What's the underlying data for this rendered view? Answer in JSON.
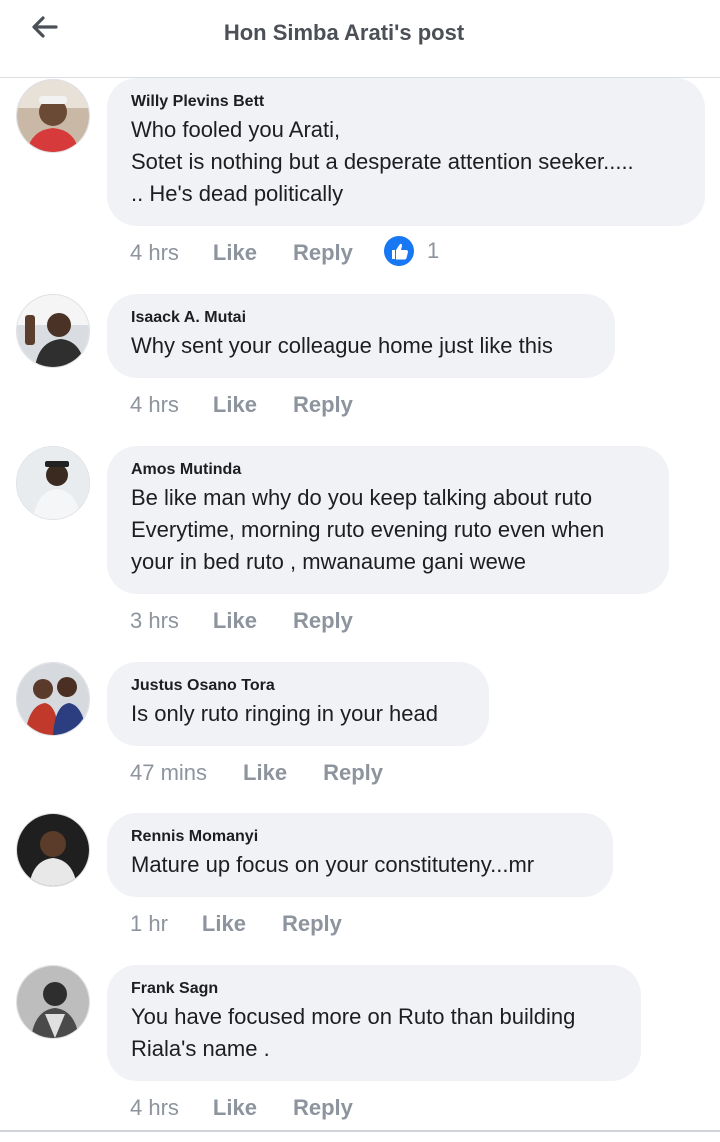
{
  "header": {
    "title": "Hon Simba Arati's post",
    "back_icon": "arrow-left-icon"
  },
  "comments": [
    {
      "author": "Willy Plevins Bett",
      "lines": [
        "Who fooled you Arati,",
        "Sotet is nothing but a desperate attention seeker.....",
        ".. He's dead politically"
      ],
      "time": "4 hrs",
      "like": "Like",
      "reply": "Reply",
      "reaction_count": "1"
    },
    {
      "author": "Isaack A. Mutai",
      "lines": [
        "Why sent your colleague home just like this"
      ],
      "time": "4 hrs",
      "like": "Like",
      "reply": "Reply"
    },
    {
      "author": "Amos Mutinda",
      "lines": [
        "Be like man why do you keep talking about ruto",
        "Everytime, morning ruto evening ruto even when",
        "your in bed ruto , mwanaume gani wewe"
      ],
      "time": "3 hrs",
      "like": "Like",
      "reply": "Reply"
    },
    {
      "author": "Justus Osano Tora",
      "lines": [
        "Is only ruto ringing in your head"
      ],
      "time": "47 mins",
      "like": "Like",
      "reply": "Reply"
    },
    {
      "author": "Rennis Momanyi",
      "lines": [
        "Mature up focus on your constituteny...mr"
      ],
      "time": "1 hr",
      "like": "Like",
      "reply": "Reply"
    },
    {
      "author": "Frank Sagn",
      "lines": [
        "You have focused more on Ruto than building",
        "Riala's name ."
      ],
      "time": "4 hrs",
      "like": "Like",
      "reply": "Reply"
    }
  ],
  "colors": {
    "bubble": "#f0f2f5",
    "like_blue": "#1877f2",
    "meta_gray": "#8d949e"
  }
}
